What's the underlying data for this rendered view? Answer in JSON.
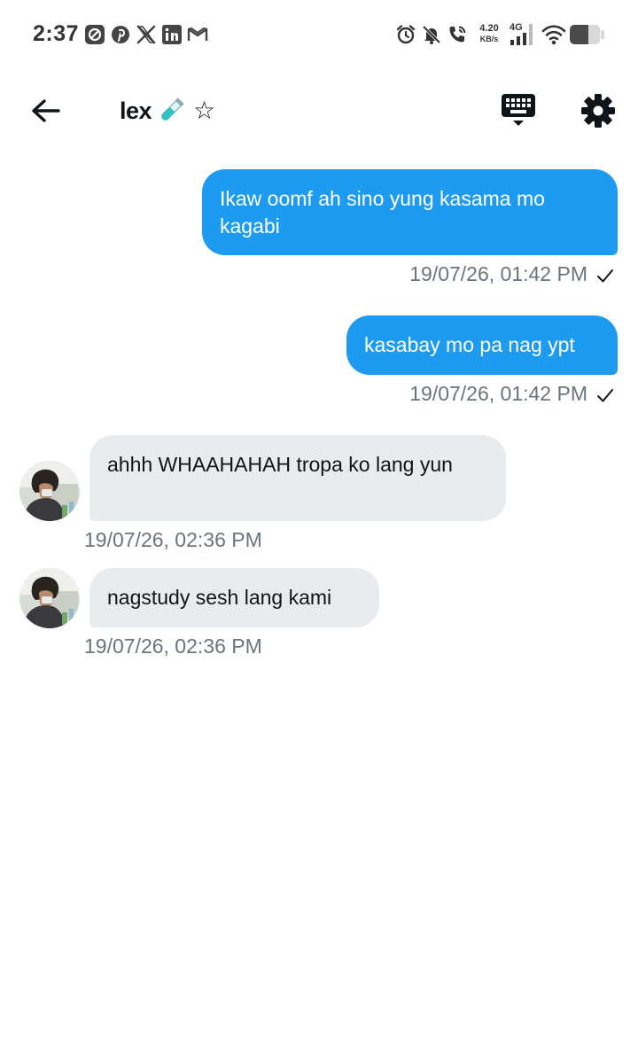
{
  "status_bar": {
    "time": "2:37",
    "net_speed_value": "4.20",
    "net_speed_unit": "KB/s",
    "network_type": "4G",
    "battery_level": 0.62,
    "notification_icons": [
      "data-saver-icon",
      "pinterest-icon",
      "x-icon",
      "linkedin-icon",
      "gmail-icon"
    ],
    "system_icons": [
      "alarm-icon",
      "muted-bell-icon",
      "wifi-calling-icon",
      "signal-icon",
      "wifi-icon",
      "battery-icon"
    ]
  },
  "header": {
    "contact_name": "lex",
    "name_emoji_icon": "test-tube-icon",
    "badge_icon": "star-icon",
    "star_glyph": "☆",
    "back_icon": "arrow-left-icon",
    "keyboard_icon": "keyboard-icon",
    "settings_icon": "gear-icon"
  },
  "colors": {
    "outgoing_bubble": "#1d9bf0",
    "incoming_bubble": "#e8ecef",
    "timestamp": "#6a747c",
    "text": "#0f1419"
  },
  "messages": [
    {
      "direction": "outgoing",
      "text": "Ikaw oomf ah sino yung kasama mo kagabi",
      "timestamp": "19/07/26, 01:42 PM",
      "status_icon": "check-icon"
    },
    {
      "direction": "outgoing",
      "text": "kasabay mo pa nag ypt",
      "timestamp": "19/07/26, 01:42 PM",
      "status_icon": "check-icon"
    },
    {
      "direction": "incoming",
      "text": "ahhh WHAAHAHAH tropa ko lang yun",
      "timestamp": "19/07/26, 02:36 PM",
      "avatar_icon": "avatar"
    },
    {
      "direction": "incoming",
      "text": "nagstudy sesh lang kami",
      "timestamp": "19/07/26, 02:36 PM",
      "avatar_icon": "avatar"
    }
  ]
}
